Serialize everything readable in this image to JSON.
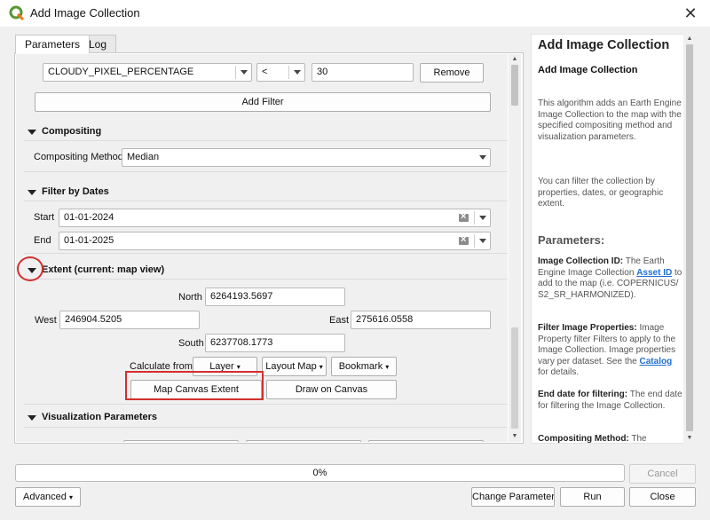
{
  "window": {
    "title": "Add Image Collection"
  },
  "tabs": [
    {
      "label": "Parameters"
    },
    {
      "label": "Log"
    }
  ],
  "filter": {
    "property_value": "CLOUDY_PIXEL_PERCENTAGE",
    "operator_value": "<",
    "threshold_value": "30",
    "remove_label": "Remove",
    "add_filter_label": "Add Filter"
  },
  "compositing": {
    "header": "Compositing",
    "method_label": "Compositing Method",
    "method_value": "Median"
  },
  "dates": {
    "header": "Filter by Dates",
    "start_label": "Start",
    "start_value": "01-01-2024",
    "end_label": "End",
    "end_value": "01-01-2025"
  },
  "extent": {
    "header": "Extent (current: map view)",
    "north_label": "North",
    "north_value": "6264193.5697",
    "west_label": "West",
    "west_value": "246904.5205",
    "east_label": "East",
    "east_value": "275616.0558",
    "south_label": "South",
    "south_value": "6237708.1773",
    "calc_from_label": "Calculate from",
    "layer_label": "Layer",
    "layout_map_label": "Layout Map",
    "bookmark_label": "Bookmark",
    "map_canvas_label": "Map Canvas Extent",
    "draw_canvas_label": "Draw on Canvas"
  },
  "visualization": {
    "header": "Visualization Parameters"
  },
  "help": {
    "title": "Add Image Collection",
    "subtitle": "Add Image Collection",
    "intro": "This algorithm adds an Earth Engine Image Collection to the map with the specified compositing method and visualization parameters.",
    "filter_note": "You can filter the collection by properties, dates, or geographic extent.",
    "params_header": "Parameters:",
    "p1_name": "Image Collection ID:",
    "p1_text_a": " The Earth Engine Image Collection ",
    "p1_link": "Asset ID",
    "p1_text_b": " to add to the map (i.e. COPERNICUS/ S2_SR_HARMONIZED).",
    "p2_name": "Filter Image Properties:",
    "p2_text_a": " Image Property filter Filters to apply to the Image Collection. Image properties vary per dataset. See the ",
    "p2_link": "Catalog",
    "p2_text_b": " for details.",
    "p3_name": "End date for filtering:",
    "p3_text": " The end date for filtering the Image Collection.",
    "p4_name": "Compositing Method:",
    "p4_text": " The"
  },
  "footer": {
    "progress_text": "0%",
    "progress": 0,
    "cancel_label": "Cancel",
    "advanced_label": "Advanced",
    "change_params_label": "Change Parameters",
    "run_label": "Run",
    "close_label": "Close"
  }
}
